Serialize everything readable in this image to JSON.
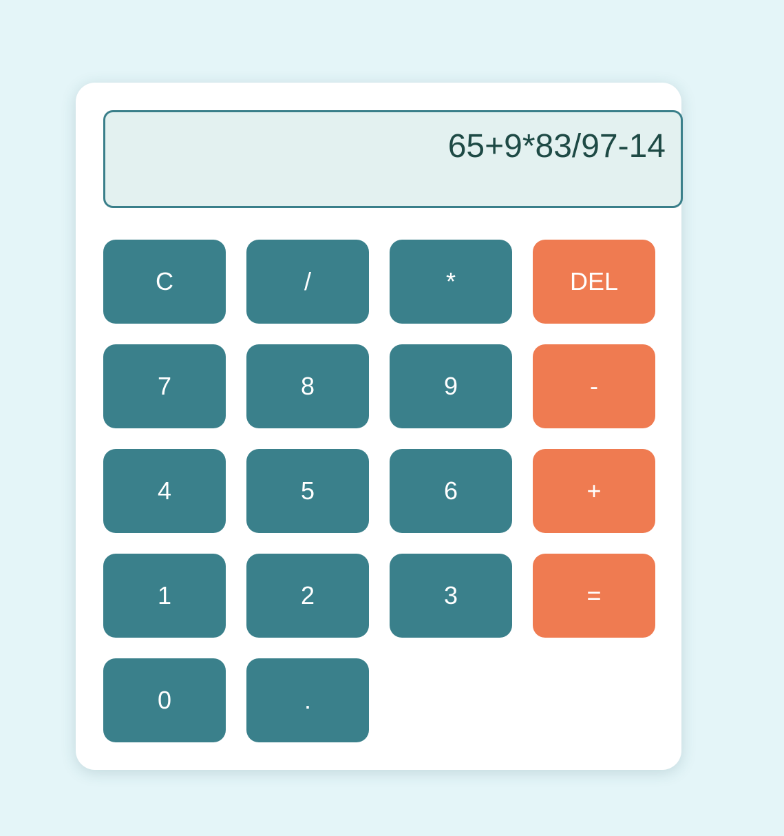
{
  "display": {
    "expression": "65+9*83/97-14"
  },
  "keys": {
    "clear": "C",
    "divide": "/",
    "multiply": "*",
    "delete": "DEL",
    "seven": "7",
    "eight": "8",
    "nine": "9",
    "minus": "-",
    "four": "4",
    "five": "5",
    "six": "6",
    "plus": "+",
    "one": "1",
    "two": "2",
    "three": "3",
    "equals": "=",
    "zero": "0",
    "decimal": "."
  },
  "colors": {
    "page_background": "#e4f5f8",
    "card_background": "#ffffff",
    "display_background": "#e3f1f0",
    "display_border": "#3a7f8a",
    "display_text": "#1e4a45",
    "number_key": "#3a808b",
    "operator_key": "#ef7b51",
    "key_text": "#ffffff"
  }
}
